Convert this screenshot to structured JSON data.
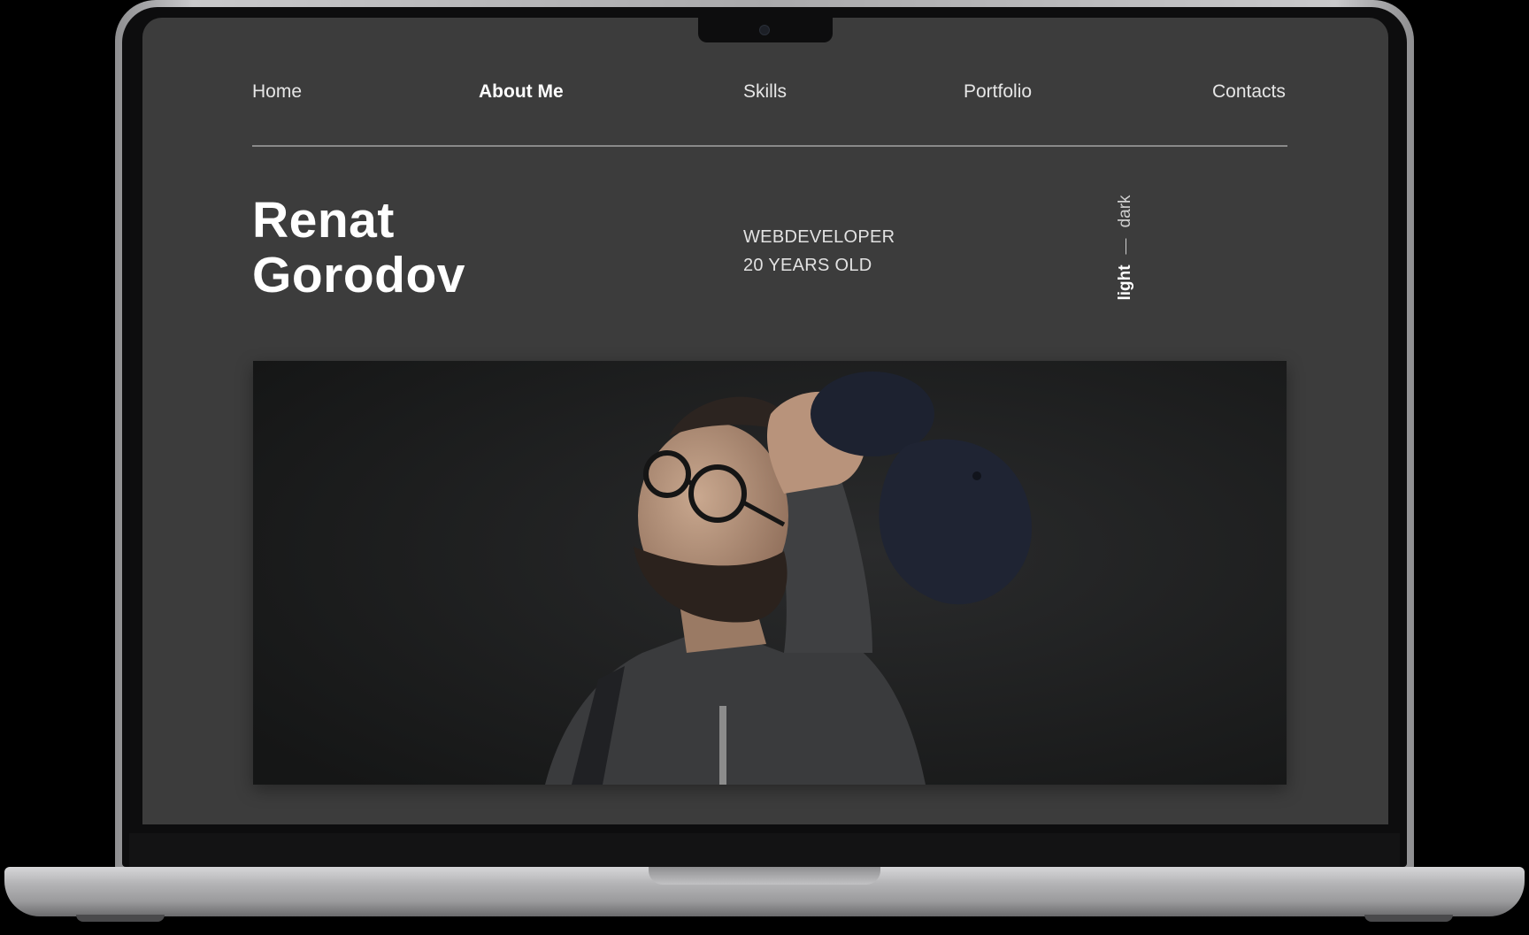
{
  "nav": {
    "items": [
      {
        "label": "Home",
        "active": false
      },
      {
        "label": "About Me",
        "active": true
      },
      {
        "label": "Skills",
        "active": false
      },
      {
        "label": "Portfolio",
        "active": false
      },
      {
        "label": "Contacts",
        "active": false
      }
    ]
  },
  "hero": {
    "first_name": "Renat",
    "last_name": "Gorodov",
    "role": "WEBDEVELOPER",
    "age": "20 YEARS OLD"
  },
  "theme_switch": {
    "light_label": "light",
    "dark_label": "dark",
    "selected": "light"
  },
  "colors": {
    "page_background": "#3c3c3c",
    "text_primary": "#ffffff",
    "divider": "#8a8a8a"
  }
}
